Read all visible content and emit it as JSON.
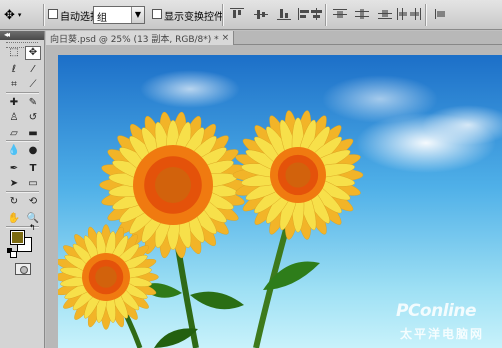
{
  "options_bar": {
    "tool_icon": "move-tool-icon",
    "auto_select_label": "自动选择:",
    "auto_select_checked": false,
    "auto_select_value": "组",
    "show_transform_label": "显示变换控件",
    "show_transform_checked": false
  },
  "tools": {
    "collapse_glyph": "◂◂",
    "items": [
      "rect-marquee-icon",
      "move-icon",
      "lasso-icon",
      "magic-wand-icon",
      "crop-icon",
      "eyedropper-icon",
      "healing-brush-icon",
      "brush-icon",
      "clone-stamp-icon",
      "history-brush-icon",
      "eraser-icon",
      "gradient-icon",
      "blur-icon",
      "dodge-icon",
      "pen-icon",
      "type-icon",
      "path-select-icon",
      "shape-icon",
      "3d-rotate-icon",
      "3d-orbit-icon",
      "hand-icon",
      "zoom-icon"
    ],
    "foreground_color": "#7b6a10",
    "background_color": "#ffffff"
  },
  "document": {
    "tab_title": "向日葵.psd @ 25% (13 副本, RGB/8*) *",
    "close_glyph": "×"
  },
  "watermark": {
    "brand": "PConline",
    "tagline": "太平洋电脑网"
  }
}
